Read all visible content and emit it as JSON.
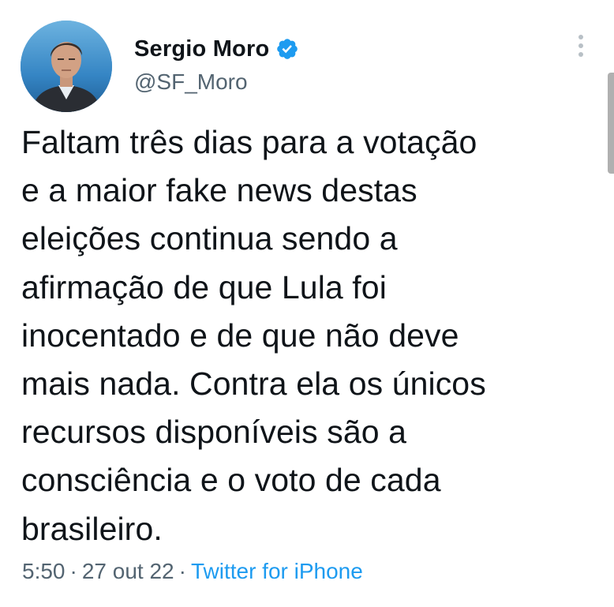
{
  "author": {
    "display_name": "Sergio Moro",
    "handle": "@SF_Moro",
    "verified": true
  },
  "tweet": {
    "text_lines": [
      "Faltam três dias para a votação",
      "e a maior fake news destas",
      "eleições continua sendo a",
      "afirmação de que Lula foi",
      "inocentado e de que não deve",
      "mais nada. Contra ela os únicos",
      "recursos disponíveis são a",
      "consciência e o voto de cada",
      "brasileiro."
    ]
  },
  "meta": {
    "time": "5:50",
    "separator": "·",
    "date": "27 out 22",
    "source": "Twitter for iPhone"
  },
  "colors": {
    "text": "#0f1419",
    "secondary": "#536471",
    "link": "#1d9bf0",
    "verified_badge": "#1d9bf0"
  },
  "icons": {
    "verified": "verified-badge-icon",
    "more": "more-vertical-icon"
  }
}
